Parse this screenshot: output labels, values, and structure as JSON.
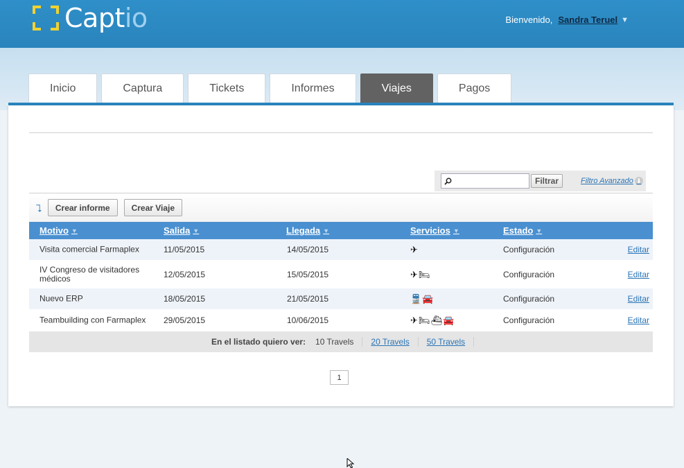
{
  "app": {
    "logo_main": "Capt",
    "logo_accent": "io",
    "welcome_label": "Bienvenido,",
    "user_name": "Sandra Teruel",
    "user_caret": "▼"
  },
  "tabs": [
    {
      "label": "Inicio"
    },
    {
      "label": "Captura"
    },
    {
      "label": "Tickets"
    },
    {
      "label": "Informes"
    },
    {
      "label": "Viajes",
      "active": true
    },
    {
      "label": "Pagos"
    }
  ],
  "search": {
    "value": "",
    "filter_label": "Filtrar",
    "advanced_label": "Filtro Avanzado"
  },
  "toolbar": {
    "create_report": "Crear informe",
    "create_trip": "Crear Viaje"
  },
  "table": {
    "columns": {
      "motivo": "Motivo",
      "salida": "Salida",
      "llegada": "Llegada",
      "servicios": "Servicios",
      "estado": "Estado"
    },
    "rows": [
      {
        "motivo": "Visita comercial Farmaplex",
        "salida": "11/05/2015",
        "llegada": "14/05/2015",
        "servicios": [
          "plane-icon"
        ],
        "estado": "Configuración",
        "action": "Editar"
      },
      {
        "motivo": "IV Congreso de visitadores médicos",
        "salida": "12/05/2015",
        "llegada": "15/05/2015",
        "servicios": [
          "plane-icon",
          "hotel-icon"
        ],
        "estado": "Configuración",
        "action": "Editar"
      },
      {
        "motivo": "Nuevo ERP",
        "salida": "18/05/2015",
        "llegada": "21/05/2015",
        "servicios": [
          "train-icon",
          "car-icon"
        ],
        "estado": "Configuración",
        "action": "Editar"
      },
      {
        "motivo": "Teambuilding con Farmaplex",
        "salida": "29/05/2015",
        "llegada": "10/06/2015",
        "servicios": [
          "plane-icon",
          "hotel-icon",
          "ship-icon",
          "car-icon"
        ],
        "estado": "Configuración",
        "action": "Editar"
      }
    ]
  },
  "pager": {
    "label": "En el listado quiero ver:",
    "options": [
      "10 Travels",
      "20 Travels",
      "50 Travels"
    ],
    "current_page": "1"
  }
}
